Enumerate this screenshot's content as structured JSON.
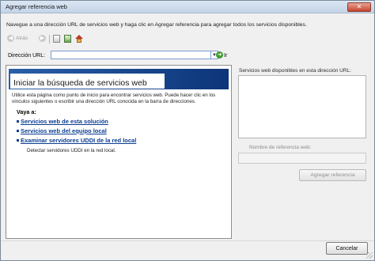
{
  "window": {
    "title": "Agregar referencia web",
    "close_glyph": "✕"
  },
  "instruction": "Navegue a una dirección URL de servicios web y haga clic en Agregar referencia para agregar todos los servicios disponibles.",
  "toolbar": {
    "back_label": "Atrás",
    "back_icon": "back-arrow-icon",
    "forward_icon": "forward-arrow-icon",
    "stop_icon": "stop-page-icon",
    "refresh_icon": "refresh-icon",
    "home_icon": "home-icon"
  },
  "url": {
    "label": "Dirección URL:",
    "value": "",
    "placeholder": "",
    "go_label": "Ir"
  },
  "browser": {
    "banner_title": "Iniciar la búsqueda de servicios web",
    "intro": "Utilice esta página como punto de inicio para encontrar servicios web. Puede hacer clic en los vínculos siguientes o escribir una dirección URL conocida en la barra de direcciones.",
    "goto_label": "Vaya a:",
    "links": [
      {
        "label": "Servicios web de esta solución"
      },
      {
        "label": "Servicios web del equipo local"
      },
      {
        "label": "Examinar servidores UDDI de la red local",
        "desc": "Detectar servidores UDDI en la red local."
      }
    ],
    "banner_colors": [
      "#2a5fa8",
      "#0d3579"
    ]
  },
  "side": {
    "available_label": "Servicios web disponibles en esta dirección URL:",
    "ref_name_label": "Nombre de referencia web:",
    "ref_name_value": "",
    "add_button": "Agregar referencia"
  },
  "footer": {
    "cancel_button": "Cancelar"
  }
}
